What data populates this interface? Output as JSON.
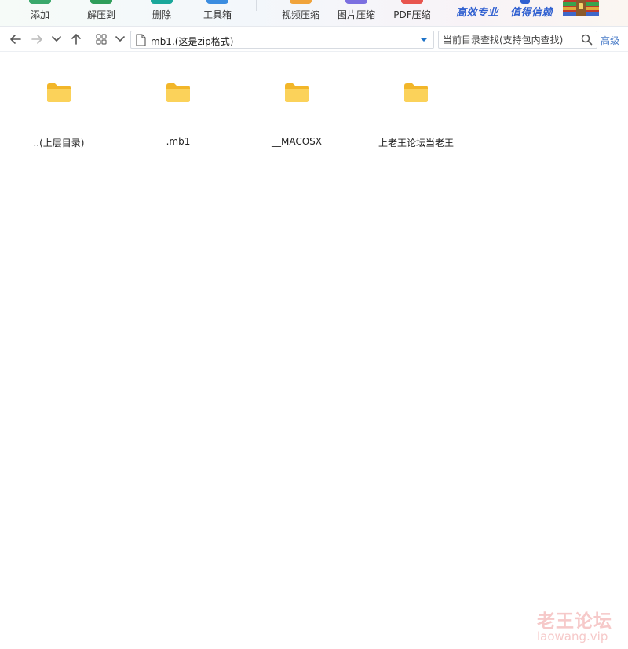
{
  "toolbar": {
    "buttons": [
      {
        "label": "添加",
        "icon": "add-icon",
        "color": "#3aa86b"
      },
      {
        "label": "解压到",
        "icon": "extract-icon",
        "color": "#2f9e5a"
      },
      {
        "label": "删除",
        "icon": "delete-icon",
        "color": "#1aa79a"
      },
      {
        "label": "工具箱",
        "icon": "toolbox-icon",
        "color": "#3b8de0"
      },
      {
        "label": "视频压缩",
        "icon": "video-compress-icon",
        "color": "#f0a33b"
      },
      {
        "label": "图片压缩",
        "icon": "image-compress-icon",
        "color": "#7b6fe0"
      },
      {
        "label": "PDF压缩",
        "icon": "pdf-compress-icon",
        "color": "#e8554e"
      }
    ],
    "slogan_1": "高效专业",
    "slogan_2": "值得信赖",
    "brand_color": "#2f5fd0"
  },
  "navbar": {
    "path": "mb1.(这是zip格式)",
    "search_placeholder": "当前目录查找(支持包内查找)",
    "advanced_label": "高级",
    "accent": "#1e73c8"
  },
  "files": [
    {
      "name": "..(上层目录)",
      "icon": "folder-icon"
    },
    {
      "name": ".mb1",
      "icon": "folder-icon"
    },
    {
      "name": "__MACOSX",
      "icon": "folder-icon"
    },
    {
      "name": "上老王论坛当老王",
      "icon": "folder-icon"
    }
  ],
  "folder_color": "#f7c948",
  "watermark": {
    "cn": "老王论坛",
    "en": "laowang.vip",
    "color": "#f6c9c9"
  }
}
